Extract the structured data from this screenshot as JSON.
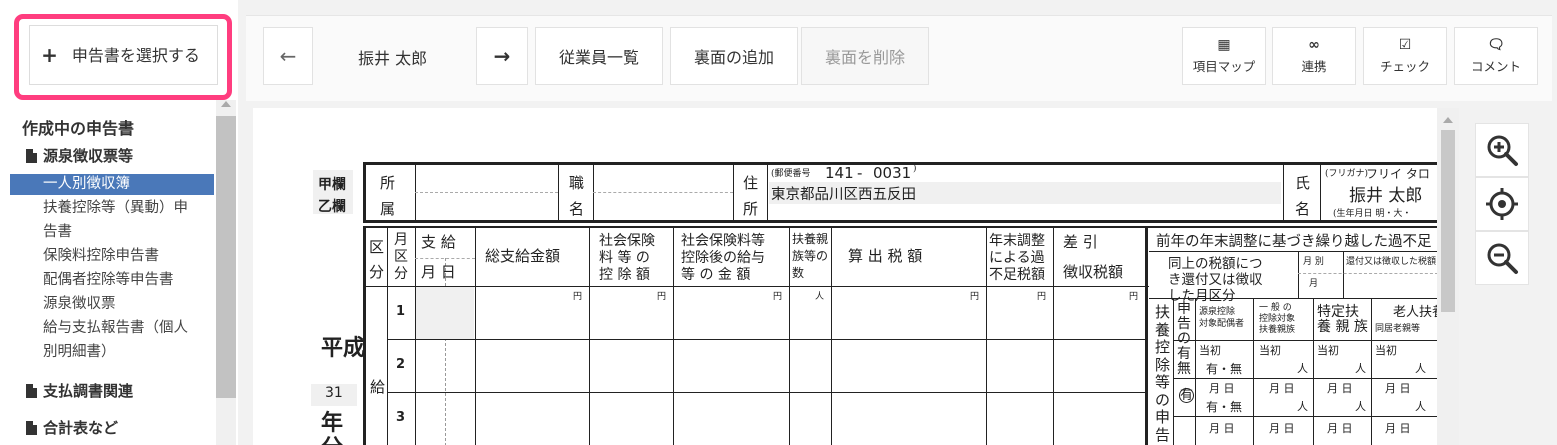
{
  "sidebar": {
    "select_button": "申告書を選択する",
    "section_title": "作成中の申告書",
    "groups": [
      {
        "label": "源泉徴収票等"
      },
      {
        "label": "支払調書関連"
      },
      {
        "label": "合計表など"
      }
    ],
    "items": [
      "一人別徴収簿",
      "扶養控除等（異動）申",
      "告書",
      "保険料控除申告書",
      "配偶者控除等申告書",
      "源泉徴収票",
      "給与支払報告書（個人",
      "別明細書）"
    ]
  },
  "toolbar": {
    "employee_name": "振井 太郎",
    "employee_list": "従業員一覧",
    "add_back": "裏面の追加",
    "delete_back": "裏面を削除",
    "item_map": "項目マップ",
    "link": "連携",
    "check": "チェック",
    "comment": "コメント"
  },
  "form": {
    "kou_label": "甲欄",
    "otsu_label": "乙欄",
    "sho": "所",
    "zoku": "属",
    "shoku": "職",
    "mei": "名",
    "ju": "住",
    "sho2": "所",
    "postal_label": "(郵便番号",
    "postal_code_1": "141",
    "postal_dash": "-",
    "postal_code_2": "0031",
    "postal_close": ")",
    "address": "東京都品川区西五反田",
    "shi": "氏",
    "mei2": "名",
    "furigana_label": "(フリガナ)",
    "furigana": "フリイ タロ",
    "name": "振井 太郎",
    "birth_label": "(生年月日 明・大・",
    "col_ku": "区",
    "col_bun": "分",
    "col_tsuki_kubun": [
      "月",
      "区",
      "分"
    ],
    "col_shikyu": "支 給",
    "col_tsuki_hi": "月 日",
    "col_total": "総支給金額",
    "col_social": [
      "社会保険",
      "料 等 の",
      "控 除 額"
    ],
    "col_after": [
      "社会保険料等",
      "控除後の給与",
      "等 の 金 額"
    ],
    "col_dependents": [
      "扶養親",
      "族等の",
      "数"
    ],
    "col_tax": "算 出 税 額",
    "col_adjust": [
      "年末調整",
      "による過",
      "不足税額"
    ],
    "col_sashihiki": "差 引",
    "col_withheld": "徴収税額",
    "yen": "円",
    "person": "人",
    "rows": [
      "1",
      "2",
      "3"
    ],
    "era": "平成",
    "era_year": "31",
    "nen": "年",
    "bun": "分",
    "kyu": "給",
    "right_title": "前年の年末調整に基づき繰り越した過不足",
    "right_sub": [
      "同上の税額につ",
      "き還付又は徴収",
      "した月区分"
    ],
    "tsuki_betsu": "月 別",
    "tsuki": "月",
    "refund_label": "還付又は徴収した税額",
    "fuyo_vertical": "扶養控除等の申告",
    "shinkoku": "申告の有無",
    "gensen": [
      "源泉控除",
      "対象配偶者"
    ],
    "ippan": [
      "一 般 の",
      "控除対象",
      "扶養親族"
    ],
    "tokutei": "特定扶",
    "tokutei2": "養 親 族",
    "rojin": "老人扶養",
    "dokyo": "同居老親等",
    "toushou": "当初",
    "umu": "有・無",
    "tsuki_hi": "月 日",
    "yu": "有"
  }
}
